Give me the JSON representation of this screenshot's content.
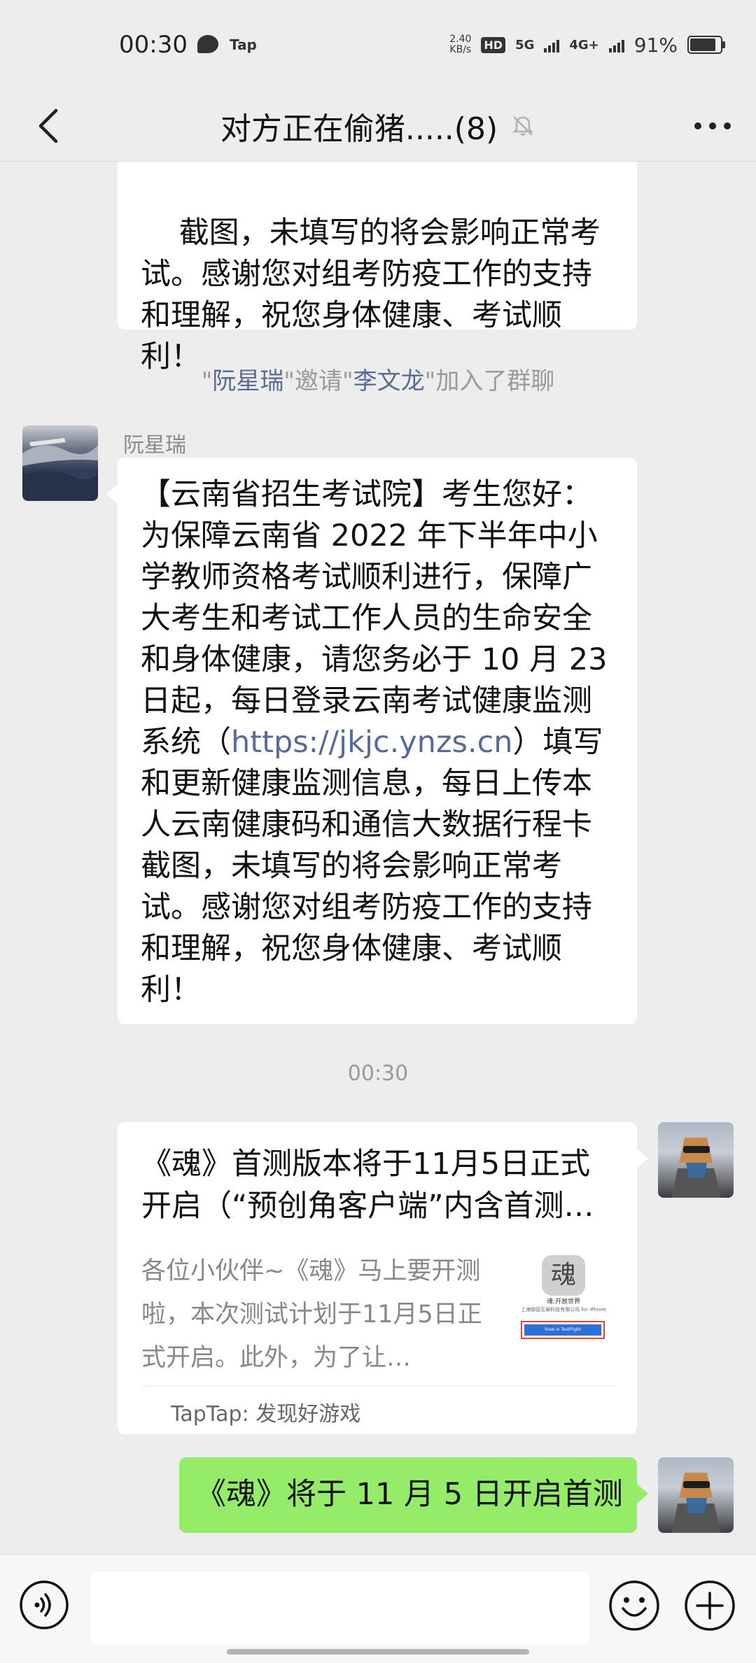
{
  "status_bar": {
    "time": "00:30",
    "tap_label": "Tap",
    "speed_value": "2.40",
    "speed_unit": "KB/s",
    "hd_label": "HD",
    "net1": "5G",
    "net2": "4G+",
    "battery_percent": "91%"
  },
  "header": {
    "title": "对方正在偷猪.....(8)",
    "icons": [
      "back-icon",
      "mute-bell-icon",
      "more-icon"
    ]
  },
  "messages": {
    "m1_text": "截图，未填写的将会影响正常考\n试。感谢您对组考防疫工作的支持\n和理解，祝您身体健康、考试顺\n利！",
    "system_q1": "\"",
    "system_inviter": "阮星瑞",
    "system_mid": "\"邀请\"",
    "system_invitee": "李文龙",
    "system_end": "\"加入了群聊",
    "sender_name": "阮星瑞",
    "m2_text_a": "【云南省招生考试院】考生您好：\n为保障云南省 2022 年下半年中小\n学教师资格考试顺利进行，保障广\n大考生和考试工作人员的生命安全\n和身体健康，请您务必于 10 月 23\n日起，每日登录云南考试健康监测\n系统（",
    "m2_link": "https://jkjc.ynzs.cn",
    "m2_text_b": "）填写\n和更新健康监测信息，每日上传本\n人云南健康码和通信大数据行程卡\n截图，未填写的将会影响正常考\n试。感谢您对组考防疫工作的支持\n和理解，祝您身体健康、考试顺\n利！",
    "timestamp": "00:30",
    "card": {
      "title": "《魂》首测版本将于11月5日正式开启（“预创角客户端”内含首测…",
      "desc": "各位小伙伴~《魂》马上要开测啦，本次测试计划于11月5日正式开启。此外，为了让…",
      "thumb_logo": "魂",
      "thumb_line1": "魂:开放世界",
      "thumb_line2": "上海锦营互娱科技有限公司 for iPhone",
      "thumb_button": "View in TestFlight",
      "source": "TapTap: 发现好游戏"
    },
    "m3_text": "《魂》将于 11 月 5 日开启首测"
  },
  "input_bar": {
    "placeholder": "",
    "icons": [
      "voice-icon",
      "emoji-icon",
      "plus-icon"
    ]
  }
}
